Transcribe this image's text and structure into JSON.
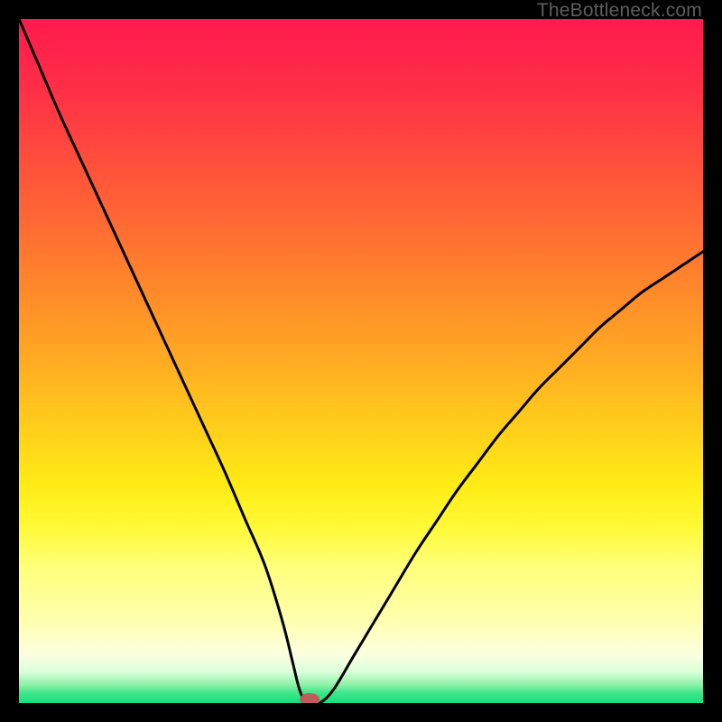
{
  "watermark": "TheBottleneck.com",
  "chart_data": {
    "type": "line",
    "title": "",
    "xlabel": "",
    "ylabel": "",
    "xlim": [
      0,
      100
    ],
    "ylim": [
      0,
      100
    ],
    "x": [
      0,
      3,
      6,
      9,
      12,
      15,
      18,
      21,
      24,
      27,
      30,
      33,
      36,
      38.5,
      40,
      41,
      42,
      43,
      44,
      46,
      49,
      52,
      55,
      58,
      61,
      64,
      67,
      70,
      73,
      76,
      79,
      82,
      85,
      88,
      91,
      94,
      97,
      100
    ],
    "values": [
      100,
      93,
      86,
      79.5,
      73,
      66.5,
      60,
      53.5,
      47,
      40.5,
      34,
      27,
      20,
      12,
      6,
      2,
      0,
      0,
      0,
      2,
      7,
      12,
      17,
      22,
      26.5,
      31,
      35,
      39,
      42.5,
      46,
      49,
      52,
      55,
      57.5,
      60,
      62,
      64,
      66
    ],
    "marker": {
      "x": 42.5,
      "y": 0
    },
    "gradient_stops": [
      {
        "pos": 0.0,
        "color": "#ff1a4d"
      },
      {
        "pos": 0.1,
        "color": "#ff2e47"
      },
      {
        "pos": 0.2,
        "color": "#ff4c3c"
      },
      {
        "pos": 0.3,
        "color": "#ff6a33"
      },
      {
        "pos": 0.4,
        "color": "#ff8a2a"
      },
      {
        "pos": 0.5,
        "color": "#ffab22"
      },
      {
        "pos": 0.6,
        "color": "#ffcf1b"
      },
      {
        "pos": 0.68,
        "color": "#ffeb15"
      },
      {
        "pos": 0.74,
        "color": "#fff933"
      },
      {
        "pos": 0.8,
        "color": "#ffff7a"
      },
      {
        "pos": 0.88,
        "color": "#ffffb0"
      },
      {
        "pos": 0.93,
        "color": "#fbffe0"
      },
      {
        "pos": 0.955,
        "color": "#d9ffd9"
      },
      {
        "pos": 0.973,
        "color": "#8ef2a8"
      },
      {
        "pos": 0.985,
        "color": "#3fe68a"
      },
      {
        "pos": 1.0,
        "color": "#17e07a"
      }
    ]
  }
}
